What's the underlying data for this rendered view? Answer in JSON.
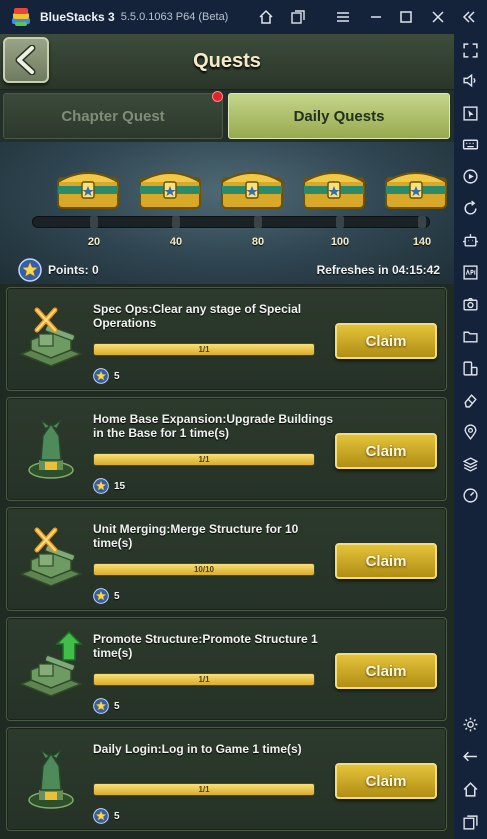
{
  "window": {
    "app_name": "BlueStacks 3",
    "version": "5.5.0.1063 P64 (Beta)"
  },
  "game": {
    "title": "Quests",
    "tabs": [
      {
        "label": "Chapter Quest",
        "active": false,
        "has_notification": true
      },
      {
        "label": "Daily Quests",
        "active": true
      }
    ],
    "milestones": [
      "20",
      "40",
      "80",
      "100",
      "140"
    ],
    "points_label": "Points: 0",
    "refresh_label": "Refreshes in 04:15:42",
    "quests": [
      {
        "title": "Spec Ops:Clear any stage of Special Operations",
        "progress_text": "1/1",
        "progress": 1.0,
        "reward": "5",
        "claim_label": "Claim",
        "icon": "crossed-swords-turret-icon"
      },
      {
        "title": "Home Base Expansion:Upgrade Buildings in the Base for 1 time(s)",
        "progress_text": "1/1",
        "progress": 1.0,
        "reward": "15",
        "claim_label": "Claim",
        "icon": "statue-icon"
      },
      {
        "title": "Unit Merging:Merge Structure for 10 time(s)",
        "progress_text": "10/10",
        "progress": 1.0,
        "reward": "5",
        "claim_label": "Claim",
        "icon": "crossed-swords-turret-icon"
      },
      {
        "title": "Promote Structure:Promote Structure 1 time(s)",
        "progress_text": "1/1",
        "progress": 1.0,
        "reward": "5",
        "claim_label": "Claim",
        "icon": "promote-turret-icon"
      },
      {
        "title": "Daily Login:Log in to Game 1 time(s)",
        "progress_text": "1/1",
        "progress": 1.0,
        "reward": "5",
        "claim_label": "Claim",
        "icon": "statue-icon"
      }
    ]
  },
  "colors": {
    "accent_gold": "#d9ab2c",
    "tab_active": "#b5c76d",
    "notification": "#e0242a"
  }
}
